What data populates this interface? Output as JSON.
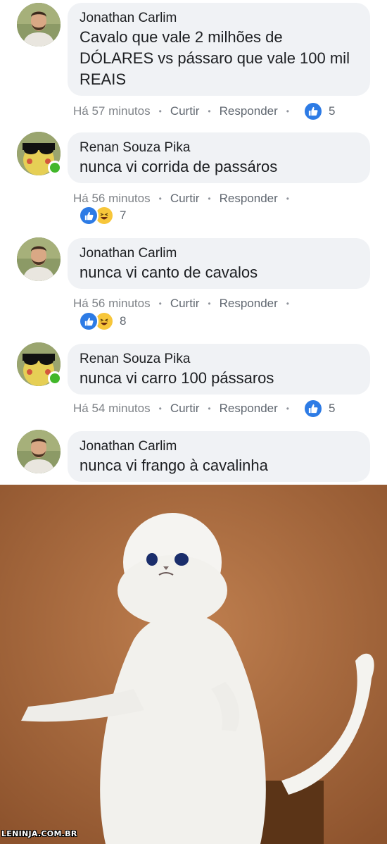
{
  "comments": [
    {
      "author": "Jonathan Carlim",
      "text": "Cavalo que vale 2 milhões de DÓLARES vs pássaro que vale 100 mil REAIS",
      "time": "Há 57 minutos",
      "like_action": "Curtir",
      "reply_action": "Responder",
      "reaction_count": "5",
      "avatar_icon": "profile-photo-man-beard"
    },
    {
      "author": "Renan Souza Pika",
      "text": "nunca vi corrida de passáros",
      "time": "Há 56 minutos",
      "like_action": "Curtir",
      "reply_action": "Responder",
      "reaction_count": "7",
      "avatar_icon": "profile-photo-pikachu-sunglasses",
      "online": true
    },
    {
      "author": "Jonathan Carlim",
      "text": "nunca vi canto de cavalos",
      "time": "Há 56 minutos",
      "like_action": "Curtir",
      "reply_action": "Responder",
      "reaction_count": "8",
      "avatar_icon": "profile-photo-man-beard"
    },
    {
      "author": "Renan Souza Pika",
      "text": "nunca vi carro 100 pássaros",
      "time": "Há 54 minutos",
      "like_action": "Curtir",
      "reply_action": "Responder",
      "reaction_count": "5",
      "avatar_icon": "profile-photo-pikachu-sunglasses",
      "online": true
    },
    {
      "author": "Jonathan Carlim",
      "text": "nunca vi frango à cavalinha",
      "avatar_icon": "profile-photo-man-beard"
    }
  ],
  "meme_image": {
    "subject": "white persian cat standing with arms open",
    "watermark": "LENINJA.COM.BR"
  },
  "colors": {
    "bubble": "#f0f2f5",
    "like_blue": "#2d7be5",
    "online_green": "#42b72a",
    "photo_background": "#a8683d"
  }
}
